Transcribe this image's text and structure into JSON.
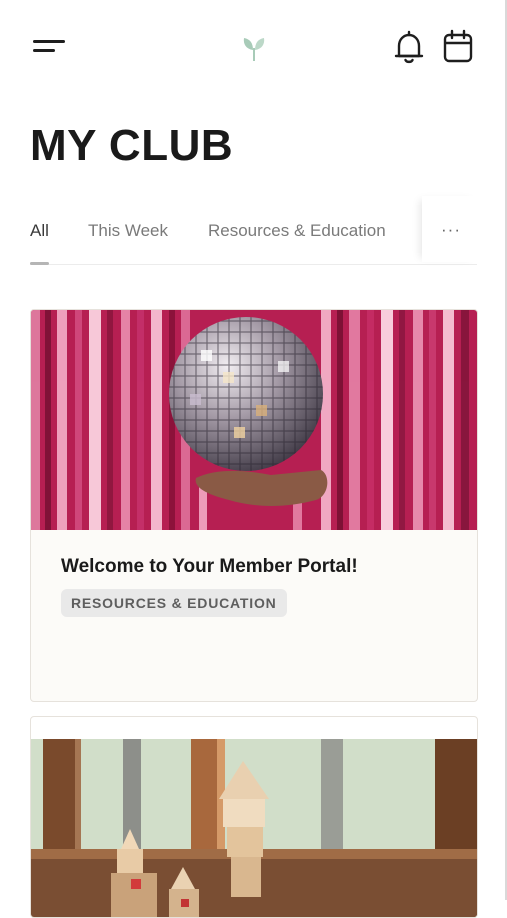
{
  "header": {
    "menu_icon": "hamburger-menu-icon",
    "logo_icon": "leaf-sprout-logo",
    "notifications_icon": "bell-icon",
    "calendar_icon": "calendar-icon"
  },
  "page": {
    "title": "MY CLUB"
  },
  "tabs": {
    "items": [
      {
        "label": "All",
        "active": true
      },
      {
        "label": "This Week",
        "active": false
      },
      {
        "label": "Resources & Education",
        "active": false
      }
    ],
    "more_label": "···"
  },
  "cards": [
    {
      "title": "Welcome to Your Member Portal!",
      "tag": "RESOURCES & EDUCATION",
      "image": "disco-ball-on-pink-tinsel-curtain"
    },
    {
      "image": "wooden-toy-blocks-on-windowsill"
    }
  ],
  "colors": {
    "accent_logo": "#a8cbb8",
    "tinsel_pink": "#c22a5c",
    "card_bg": "#fcfbf8",
    "tag_bg": "#e9e9e9"
  }
}
